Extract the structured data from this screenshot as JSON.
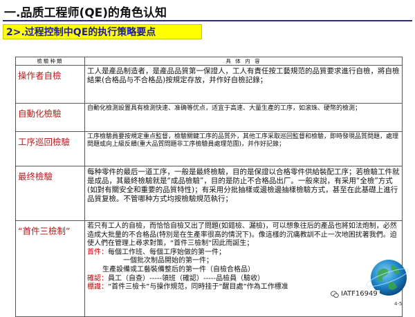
{
  "slide": {
    "title": "一.品质工程师(QE)的角色认知",
    "subtitle": "2>.过程控制中QE的执行策略要点",
    "page_number": "4-5",
    "watermark": "IATF16949"
  },
  "table": {
    "headers": [
      "檢驗种類",
      "具 体 内 容"
    ],
    "rows": [
      {
        "type": "操作者自檢",
        "lines": [
          "工人是產品制造者，是產品品質第一保證人，工人有責任按工藝規范的品質要求進行自檢，將自檢結果(合格品与不合格品)按規定存放，并作好自檢記錄；"
        ]
      },
      {
        "type": "自動化檢驗",
        "lines": [
          "自動化檢測設置具有檢測快速、准确等优点，适宜于高速、大量生產的工序，如滚珠、硬幣的檢測；"
        ]
      },
      {
        "type": "工序巡回檢驗",
        "lines": [
          "工序檢驗員要按規定重点監督，檢驗關鍵工序的品質外，其他工序采取巡回監督和檢驗，即時發現品質問題，處理問題或向上級反饋(重大品質問題非工序檢驗員處理范圍)，并作好記錄；"
        ]
      },
      {
        "type": "最终檢驗",
        "lines": [
          "每种零件的最后一道工序，一般是最終檢驗，目的是保證以合格零件供給裝配工序；若檢驗工件就是成品，其最終檢驗就是“成品檢驗”，目的是防止不合格品出厂。一般來說，有采用“全檢”方式(如對有關安全和重要的品質特性)；有采用分批抽樣或邊檢邊抽樣檢驗方式，甚至在此基礎上進行品質复檢。不管哪种方式均按檢驗規范執行；"
        ]
      },
      {
        "type": "“首件三檢制”",
        "intro": "若只有工人的自檢，而恰恰自檢又出了問題(如錯檢、漏檢)，可以想象往后的產品也將如法炮制，必然造成大批量的不合格品(特別是在生產率很高的情況下)。像這樣的沉痛教訓不止一次地困扰著我們。迫使人們在管理上尋求對策，“首件三檢制”因此而誕生；",
        "first_piece_label": "首件：",
        "first_piece_lines": [
          "每個工作班、每個工序始做的第一件；",
          "一個批次制品開始的第一件；",
          "生產設備或工藝裝備整后的第一件（自檢合格品）"
        ],
        "confirm_label": "確認：",
        "confirm_text": "員工（自查）-----領班（確認）-----品檢員（驗收）",
        "mark_label": "標識：",
        "mark_text": "“首件三檢卡”与操作規范，同時挂于“醒目處”作為工作標准"
      }
    ]
  },
  "colors": {
    "title_rule": "#2a2a7a",
    "subtitle_bg": "#ffff00",
    "subtitle_text": "#1c1c9c",
    "type_text": "#b02020",
    "label_red": "#c00000"
  },
  "icons": {
    "logo": "globe-icon",
    "watermark_icon": "wechat-icon"
  }
}
